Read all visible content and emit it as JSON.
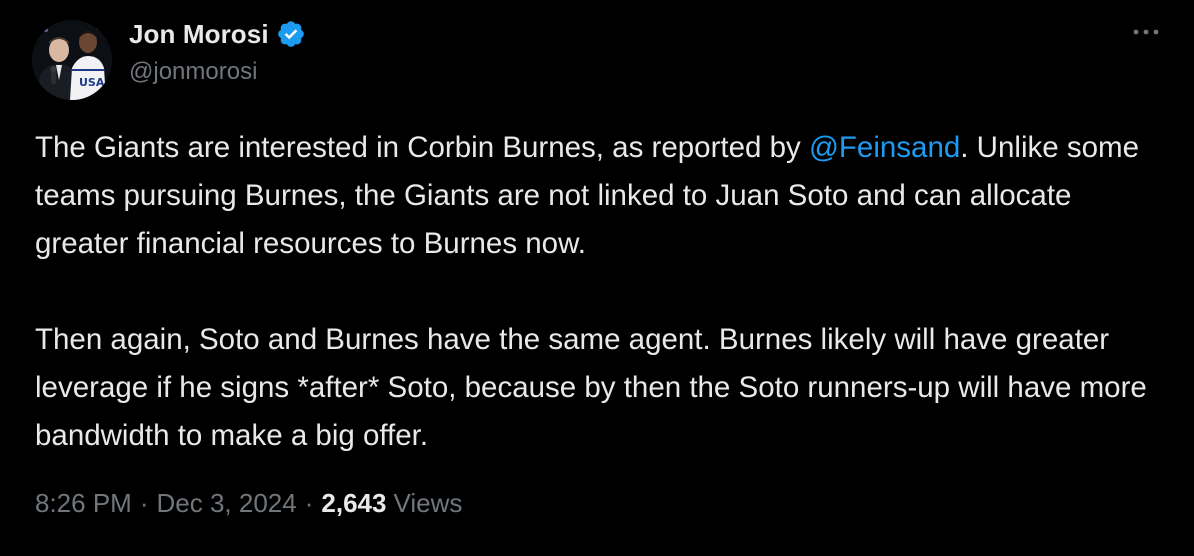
{
  "author": {
    "name": "Jon Morosi",
    "handle": "@jonmorosi",
    "verified": true,
    "verified_color": "#1d9bf0",
    "avatar_icon": "avatar-photo"
  },
  "more_icon": "more-dots-icon",
  "tweet": {
    "para1_before": "The Giants are interested in Corbin Burnes, as reported by ",
    "mention": "@Feinsand",
    "para1_after": ". Unlike some teams pursuing Burnes, the Giants are not linked to Juan Soto and can allocate greater financial resources to Burnes now.",
    "para2": "Then again, Soto and Burnes have the same agent. Burnes likely will have greater leverage if he signs *after* Soto, because by then the Soto runners-up will have more bandwidth to make a big offer."
  },
  "meta": {
    "time": "8:26 PM",
    "separator": "·",
    "date": "Dec 3, 2024",
    "views_count": "2,643",
    "views_label": "Views"
  },
  "colors": {
    "background": "#000000",
    "text": "#e7e9ea",
    "secondary": "#71767b",
    "link": "#1d9bf0"
  }
}
